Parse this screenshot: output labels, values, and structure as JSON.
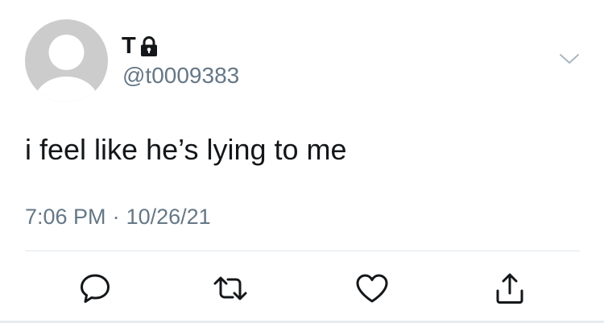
{
  "user": {
    "display_name": "T",
    "handle": "@t0009383",
    "protected_icon": "lock-icon",
    "avatar": "default-avatar"
  },
  "tweet": {
    "text": "i feel like he’s lying to me",
    "time": "7:06 PM",
    "separator": "·",
    "date": "10/26/21"
  },
  "actions": [
    {
      "name": "reply",
      "icon": "comment-icon"
    },
    {
      "name": "retweet",
      "icon": "retweet-icon"
    },
    {
      "name": "like",
      "icon": "heart-icon"
    },
    {
      "name": "share",
      "icon": "share-icon"
    }
  ],
  "menu_icon": "chevron-down-icon",
  "colors": {
    "text": "#14171a",
    "secondary": "#657786",
    "avatar_bg": "#cccccc",
    "avatar_fg": "#ffffff",
    "divider": "#e1e8ed",
    "icon": "#657786"
  }
}
